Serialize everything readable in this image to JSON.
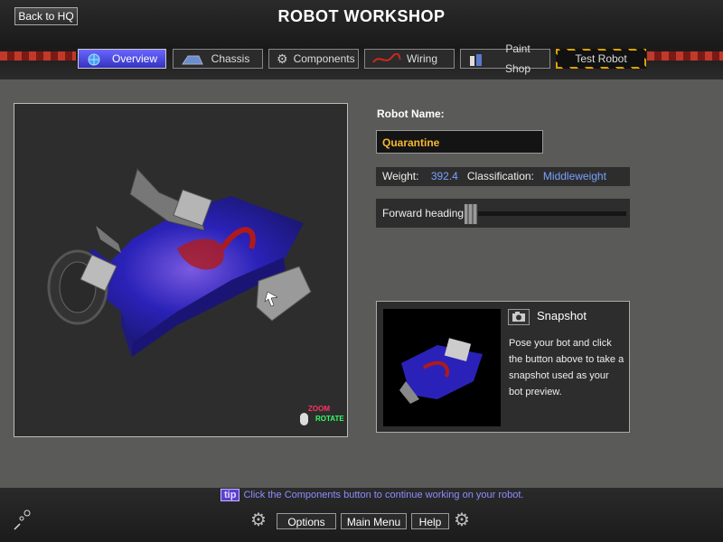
{
  "header": {
    "title": "ROBOT WORKSHOP",
    "back_label": "Back to HQ"
  },
  "tabs": [
    {
      "label": "Overview",
      "icon": "globe-icon"
    },
    {
      "label": "Chassis",
      "icon": "chassis-icon"
    },
    {
      "label": "Components",
      "icon": "gear-icon"
    },
    {
      "label": "Wiring",
      "icon": "wire-icon"
    },
    {
      "label": "Paint Shop",
      "icon": "paint-icon"
    },
    {
      "label": "Test Robot",
      "icon": ""
    }
  ],
  "robot": {
    "name_label": "Robot Name:",
    "name_value": "Quarantine",
    "weight_label": "Weight:",
    "weight_value": "392.4",
    "class_label": "Classification:",
    "class_value": "Middleweight",
    "heading_label": "Forward heading:"
  },
  "viewport": {
    "zoom_hint": "ZOOM",
    "rotate_hint": "ROTATE"
  },
  "snapshot": {
    "title": "Snapshot",
    "text": "Pose your bot and click the button above to take a snapshot used as your bot preview."
  },
  "footer": {
    "tip_badge": "tip",
    "tip_text": "Click the Components button to continue working on your robot.",
    "options_label": "Options",
    "mainmenu_label": "Main Menu",
    "help_label": "Help"
  },
  "colors": {
    "accent": "#4a48e0",
    "name": "#f5b830",
    "value": "#7aa0ff"
  }
}
